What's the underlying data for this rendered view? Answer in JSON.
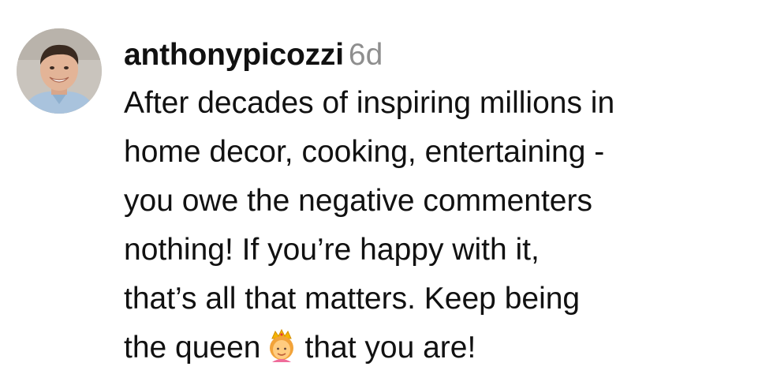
{
  "comment": {
    "username": "anthonypicozzi",
    "timestamp": "6d",
    "text_lines": [
      "After decades of inspiring millions in",
      "home decor, cooking, entertaining -",
      "you owe the negative commenters",
      "nothing! If you’re happy with it,",
      "that’s all that matters. Keep being"
    ],
    "last_line_before_emoji": "the queen",
    "emoji_icon": "princess-crown-emoji",
    "last_line_after_emoji": "that you are!"
  },
  "colors": {
    "text": "#111111",
    "timestamp": "#8e8e8e",
    "background": "#ffffff"
  }
}
